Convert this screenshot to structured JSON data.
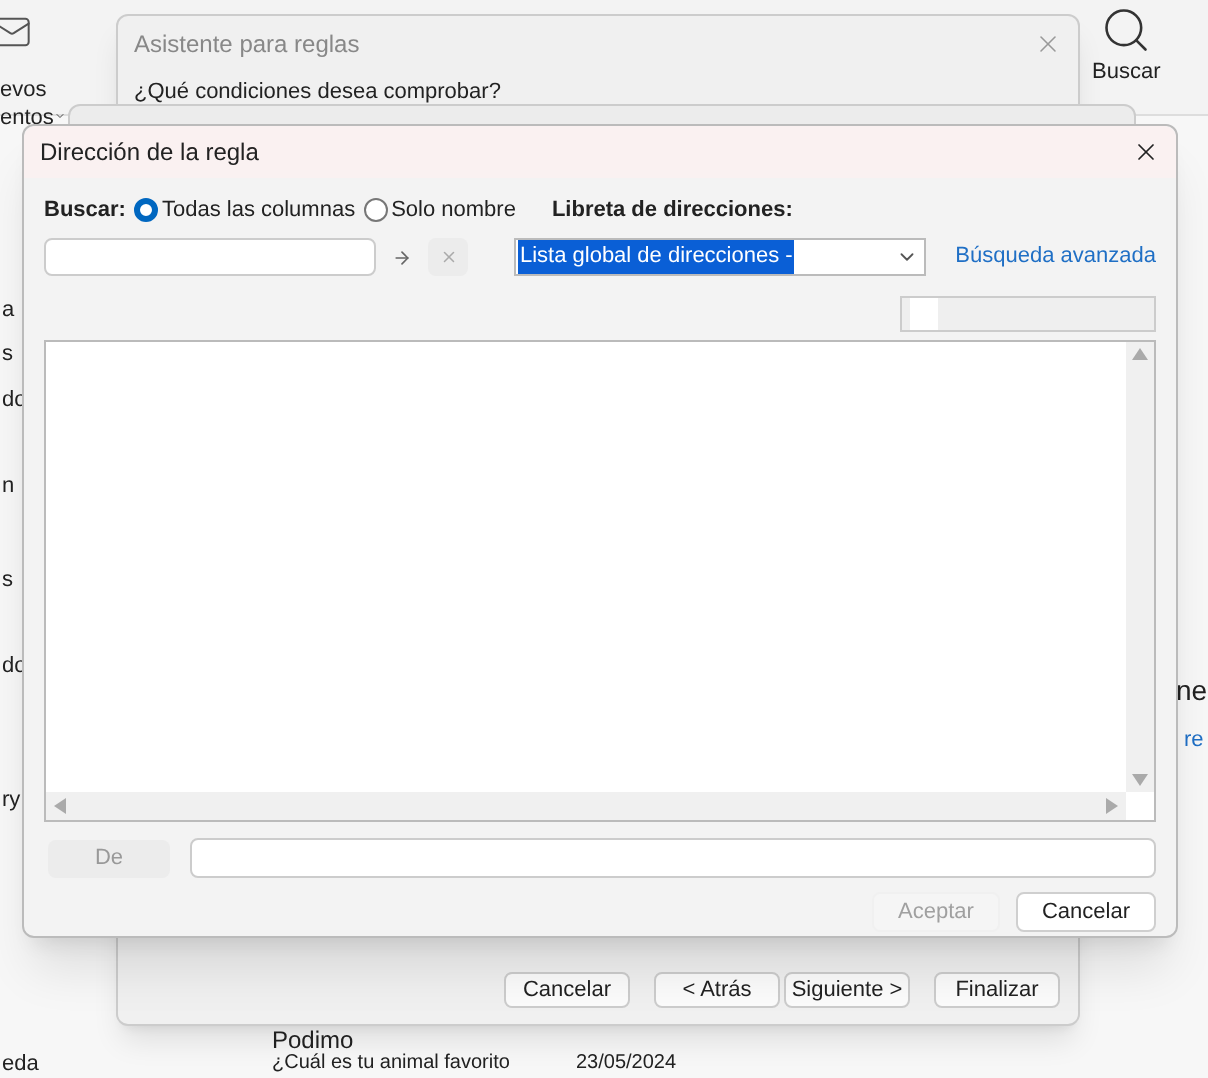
{
  "background": {
    "left_labels": [
      "evos",
      "entos"
    ],
    "side_labels": [
      "a",
      "s",
      "do",
      "n",
      "s",
      "do",
      "ry",
      "eda"
    ],
    "search_button": "Buscar",
    "right_labels": [
      "ne",
      "re"
    ],
    "message": {
      "sender": "Podimo",
      "subject": "¿Cuál es tu animal favorito",
      "date": "23/05/2024"
    }
  },
  "wizard": {
    "title": "Asistente para reglas",
    "question": "¿Qué condiciones desea comprobar?",
    "buttons": [
      "Cancelar",
      "< Atrás",
      "Siguiente >",
      "Finalizar"
    ]
  },
  "dialog": {
    "title": "Dirección de la regla",
    "search_label": "Buscar:",
    "search_options": [
      {
        "label": "Todas las columnas",
        "selected": true
      },
      {
        "label": "Solo nombre",
        "selected": false
      }
    ],
    "address_book_label": "Libreta de direcciones:",
    "address_book_value": "Lista global de direcciones -",
    "advanced_search": "Búsqueda avanzada",
    "from_button": "De",
    "ok_button": {
      "label": "Aceptar",
      "disabled": true
    },
    "cancel_button": {
      "label": "Cancelar",
      "disabled": false
    }
  }
}
